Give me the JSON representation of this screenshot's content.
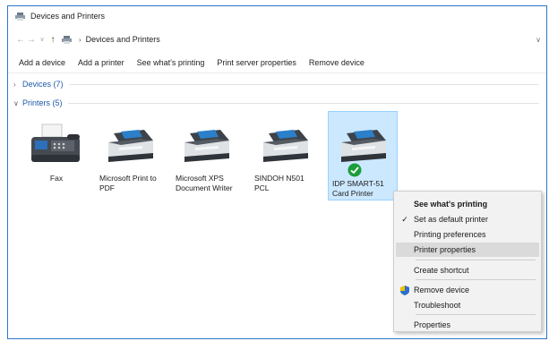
{
  "window": {
    "title": "Devices and Printers"
  },
  "nav": {
    "back_icon": "back-arrow-icon",
    "forward_icon": "forward-arrow-icon",
    "up_icon": "up-arrow-icon",
    "address_path": "Devices and Printers"
  },
  "toolbar": {
    "add_device": "Add a device",
    "add_printer": "Add a printer",
    "see_printing": "See what's printing",
    "print_server": "Print server properties",
    "remove_device": "Remove device"
  },
  "groups": {
    "devices": "Devices (7)",
    "printers": "Printers (5)"
  },
  "printers": [
    {
      "label": "Fax"
    },
    {
      "label": "Microsoft Print to PDF"
    },
    {
      "label": "Microsoft XPS Document Writer"
    },
    {
      "label": "SINDOH N501 PCL"
    },
    {
      "label": "IDP SMART-51 Card Printer",
      "default": true
    }
  ],
  "context_menu": {
    "items": [
      {
        "label": "See what's printing"
      },
      {
        "label": "Set as default printer"
      },
      {
        "label": "Printing preferences"
      },
      {
        "label": "Printer properties"
      },
      {
        "label": "Create shortcut"
      },
      {
        "label": "Remove device"
      },
      {
        "label": "Troubleshoot"
      },
      {
        "label": "Properties"
      }
    ]
  },
  "colors": {
    "accent": "#1e5aa8",
    "selection_bg": "#cce8ff",
    "default_badge": "#1b9e3a"
  }
}
